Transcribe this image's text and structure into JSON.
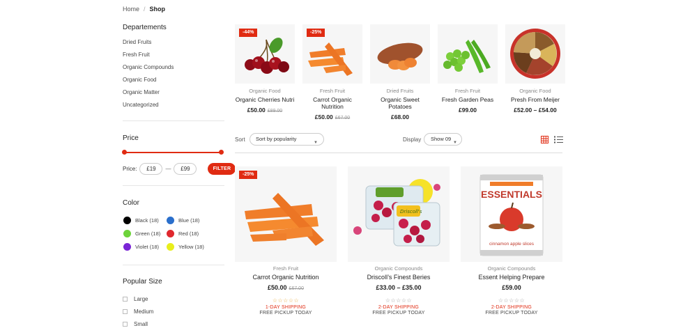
{
  "breadcrumb": {
    "home": "Home",
    "separator": "/",
    "current": "Shop"
  },
  "sidebar": {
    "departments_title": "Departements",
    "departments": [
      "Dried Fruits",
      "Fresh Fruit",
      "Organic Compounds",
      "Organic Food",
      "Organic Matter",
      "Uncategorized"
    ],
    "price_title": "Price",
    "price_label": "Price:",
    "price_min": "£19",
    "price_dash": "—",
    "price_max": "£99",
    "filter_label": "FILTER",
    "color_title": "Color",
    "colors": [
      {
        "label": "Black (18)",
        "hex": "#000000"
      },
      {
        "label": "Blue (18)",
        "hex": "#2a6fcc"
      },
      {
        "label": "Green (18)",
        "hex": "#6dd33a"
      },
      {
        "label": "Red (18)",
        "hex": "#e0282e"
      },
      {
        "label": "Violet (18)",
        "hex": "#7a25d6"
      },
      {
        "label": "Yellow (18)",
        "hex": "#e8ee1c"
      }
    ],
    "size_title": "Popular Size",
    "sizes": [
      "Large",
      "Medium",
      "Small"
    ]
  },
  "top_products": [
    {
      "badge": "-44%",
      "category": "Organic Food",
      "name": "Organic Cherries Nutri",
      "price": "£50.00",
      "old_price": "£89.00",
      "image_icon": "cherries-image"
    },
    {
      "badge": "-25%",
      "category": "Fresh Fruit",
      "name": "Carrot Organic Nutrition",
      "price": "£50.00",
      "old_price": "£67.00",
      "image_icon": "carrots-image"
    },
    {
      "badge": "",
      "category": "Dried Fruits",
      "name": "Organic Sweet Potatoes",
      "price": "£68.00",
      "old_price": "",
      "image_icon": "sweet-potato-image"
    },
    {
      "badge": "",
      "category": "Fresh Fruit",
      "name": "Fresh Garden Peas",
      "price": "£99.00",
      "old_price": "",
      "image_icon": "peas-image"
    },
    {
      "badge": "",
      "category": "Organic Food",
      "name": "Presh From Meijer",
      "price": "£52.00 – £54.00",
      "old_price": "",
      "image_icon": "spice-bowl-image"
    }
  ],
  "toolbar": {
    "sort_label": "Sort",
    "sort_value": "Sort by popularity",
    "display_label": "Display",
    "show_value": "Show 09"
  },
  "products": [
    {
      "badge": "-25%",
      "category": "Fresh Fruit",
      "name": "Carrot Organic Nutrition",
      "price": "£50.00",
      "old_price": "£67.00",
      "stars": "☆☆☆☆☆",
      "shipping": "1-DAY SHIPPING",
      "pickup": "FREE PICKUP TODAY",
      "image_icon": "carrots-image"
    },
    {
      "badge": "",
      "category": "Organic Compounds",
      "name": "Driscoll’s Finest Beries",
      "price": "£33.00 – £35.00",
      "old_price": "",
      "stars": "☆☆☆☆☆",
      "shipping": "2-DAY SHIPPING",
      "pickup": "FREE PICKUP TODAY",
      "image_icon": "berries-pack-image",
      "pack_label": "Driscoll's"
    },
    {
      "badge": "",
      "category": "Organic Compounds",
      "name": "Essent Helping Prepare",
      "price": "£59.00",
      "old_price": "",
      "stars": "☆☆☆☆☆",
      "shipping": "2-DAY SHIPPING",
      "pickup": "FREE PICKUP TODAY",
      "image_icon": "apple-can-image",
      "can_title": "ESSENTIALS",
      "can_caption": "cinnamon apple slices"
    }
  ],
  "accent": "#e02b12",
  "star_colors": [
    "#e8a93c",
    "#999999"
  ]
}
